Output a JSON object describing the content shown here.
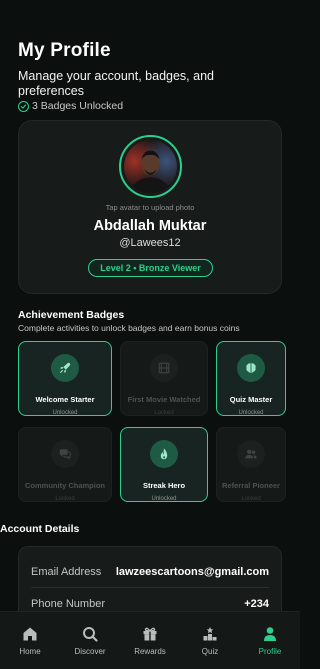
{
  "header": {
    "title": "My Profile",
    "subtitle": "Manage your account, badges, and preferences",
    "badges_unlocked": "3 Badges Unlocked"
  },
  "profile": {
    "upload_hint": "Tap avatar to upload photo",
    "name": "Abdallah Muktar",
    "handle": "@Lawees12",
    "level": "Level 2 • Bronze Viewer"
  },
  "achievements": {
    "title": "Achievement Badges",
    "subtitle": "Complete activities to unlock badges and earn bonus coins",
    "badges": [
      {
        "name": "Welcome Starter",
        "status": "Unlocked",
        "icon": "rocket-icon",
        "unlocked": true
      },
      {
        "name": "First Movie Watched",
        "status": "Locked",
        "icon": "film-icon",
        "unlocked": false
      },
      {
        "name": "Quiz Master",
        "status": "Unlocked",
        "icon": "brain-icon",
        "unlocked": true
      },
      {
        "name": "Community Champion",
        "status": "Locked",
        "icon": "chat-icon",
        "unlocked": false
      },
      {
        "name": "Streak Hero",
        "status": "Unlocked",
        "icon": "flame-icon",
        "unlocked": true
      },
      {
        "name": "Referral Pioneer",
        "status": "Locked",
        "icon": "users-icon",
        "unlocked": false
      }
    ]
  },
  "account": {
    "title": "Account Details",
    "rows": [
      {
        "label": "Email Address",
        "value": "lawzeescartoons@gmail.com"
      },
      {
        "label": "Phone Number",
        "value": "+234"
      }
    ]
  },
  "nav": [
    {
      "label": "Home",
      "icon": "home-icon",
      "active": false
    },
    {
      "label": "Discover",
      "icon": "search-icon",
      "active": false
    },
    {
      "label": "Rewards",
      "icon": "gift-icon",
      "active": false
    },
    {
      "label": "Quiz",
      "icon": "quiz-icon",
      "active": false
    },
    {
      "label": "Profile",
      "icon": "profile-icon",
      "active": true
    }
  ],
  "colors": {
    "accent": "#2ecf8e",
    "background": "#0b0f0e",
    "card": "#171b1a"
  }
}
